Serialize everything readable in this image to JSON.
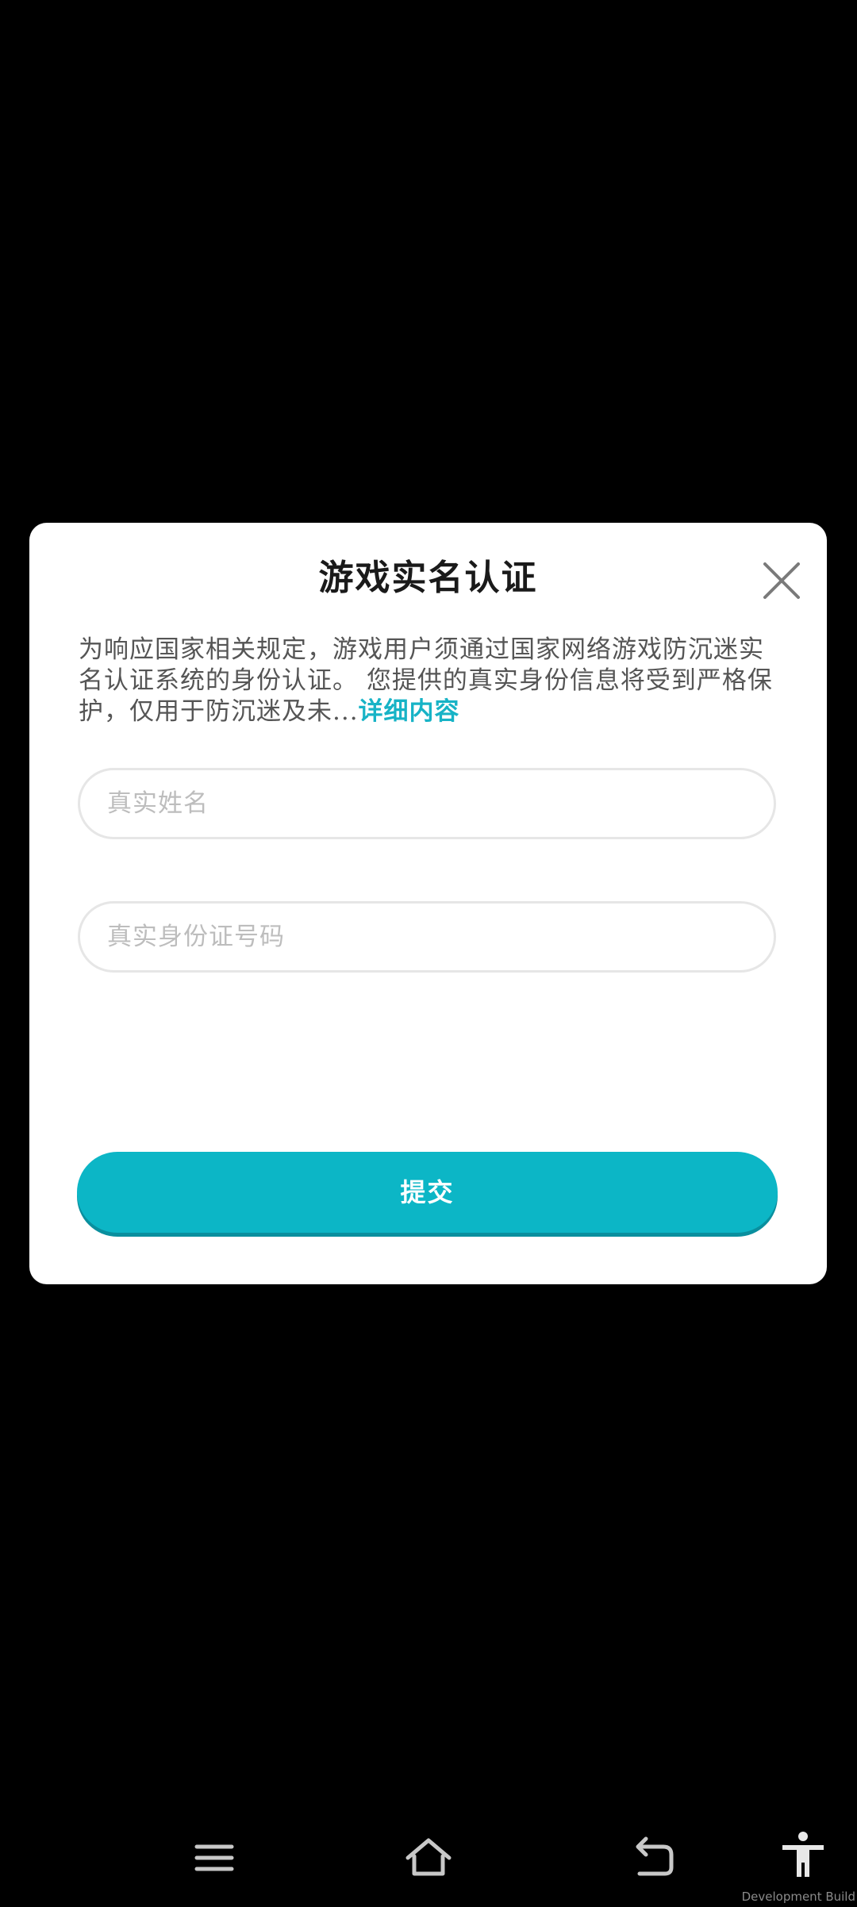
{
  "dialog": {
    "title": "游戏实名认证",
    "notice_text": "为响应国家相关规定，游戏用户须通过国家网络游戏防沉迷实名认证系统的身份认证。 您提供的真实身份信息将受到严格保护，仅用于防沉迷及未...",
    "more_link": "详细内容",
    "name_field": {
      "placeholder": "真实姓名",
      "value": ""
    },
    "id_field": {
      "placeholder": "真实身份证号码",
      "value": ""
    },
    "submit_label": "提交",
    "close_icon": "close-icon"
  },
  "navbar": {
    "icons": [
      "menu-icon",
      "home-icon",
      "back-icon",
      "accessibility-icon"
    ]
  },
  "build_label": "Development Build",
  "colors": {
    "background": "#000000",
    "dialog": "#ffffff",
    "accent": "#0cb6c6",
    "link": "#17b3c6",
    "placeholder": "#bdbdbd"
  }
}
